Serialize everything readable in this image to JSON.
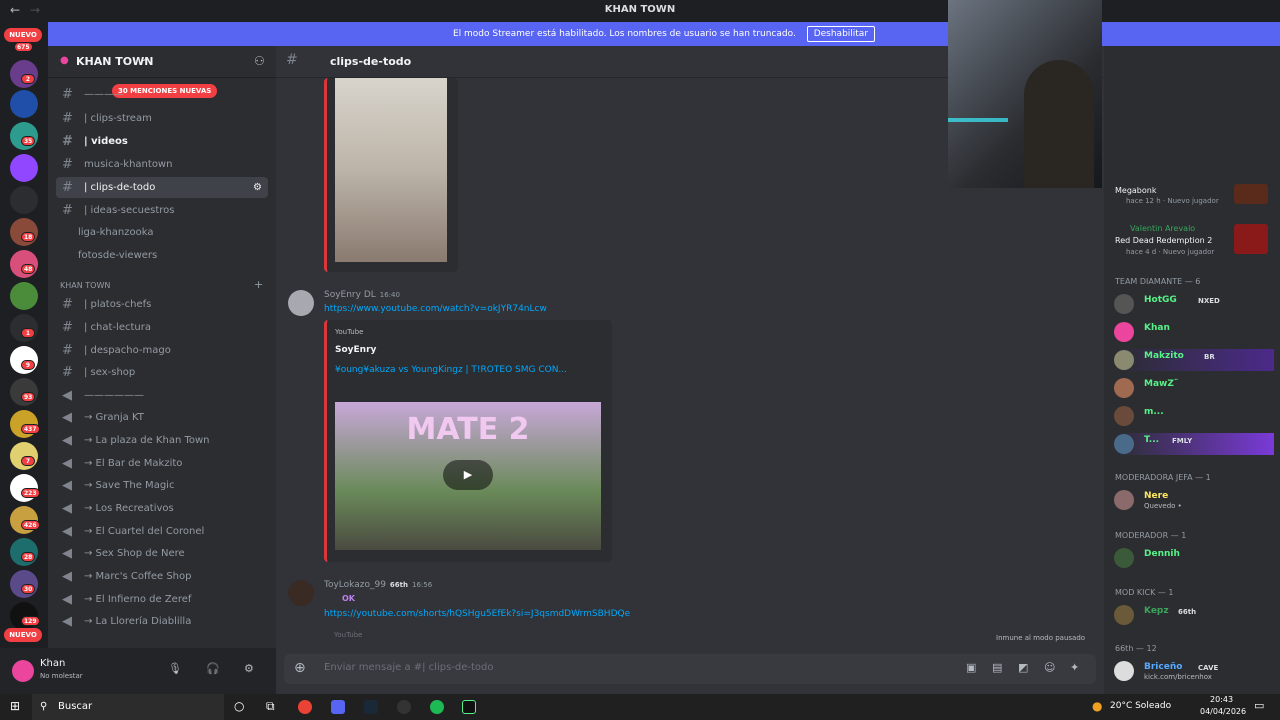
{
  "window": {
    "title": "KHAN TOWN"
  },
  "streamer_banner": {
    "text": "El modo Streamer está habilitado. Los nombres de usuario se han truncado.",
    "button": "Deshabilitar"
  },
  "guild_rail": {
    "top_badge": "NUEVO",
    "top_count": "675",
    "counts": [
      "2",
      "35",
      "18",
      "48",
      "1",
      "9",
      "93",
      "437",
      "7",
      "223",
      "426",
      "28",
      "30",
      "129"
    ],
    "bottom_badge": "NUEVO"
  },
  "server": {
    "name": "KHAN TOWN",
    "mentions_pill": "30 MENCIONES NUEVAS"
  },
  "channels": [
    {
      "label": "————",
      "unread": false
    },
    {
      "label": "| clips-stream",
      "unread": false
    },
    {
      "label": "| videos",
      "unread": true
    },
    {
      "label": "musica-khantown",
      "unread": false
    },
    {
      "label": "| clips-de-todo",
      "unread": false,
      "active": true
    },
    {
      "label": "| ideas-secuestros",
      "unread": false
    },
    {
      "label": "liga-khanzooka",
      "unread": false
    },
    {
      "label": "fotosde-viewers",
      "unread": false
    }
  ],
  "category": {
    "label": "KHAN TOWN"
  },
  "channels2": [
    {
      "label": "| platos-chefs"
    },
    {
      "label": "| chat-lectura"
    },
    {
      "label": "| despacho-mago"
    },
    {
      "label": "| sex-shop"
    },
    {
      "label": "——————"
    }
  ],
  "voice_channels": [
    {
      "label": "→ Granja KT"
    },
    {
      "label": "→ La plaza de Khan Town"
    },
    {
      "label": "→ El Bar de Makzito"
    },
    {
      "label": "→ Save The Magic"
    },
    {
      "label": "→ Los Recreativos"
    },
    {
      "label": "→ El Cuartel del Coronel"
    },
    {
      "label": "→ Sex Shop de Nere"
    },
    {
      "label": "→ Marc's Coffee Shop"
    },
    {
      "label": "→ El Infierno de Zeref"
    },
    {
      "label": "→ La Llorería Diablilla"
    }
  ],
  "user": {
    "name": "Khan",
    "status": "No molestar"
  },
  "channel_header": {
    "name": "clips-de-todo"
  },
  "messages": [
    {
      "author": "SoyEnry DL",
      "time": "16:40",
      "link": "https://www.youtube.com/watch?v=okJYR74nLcw",
      "embed": {
        "provider": "YouTube",
        "author": "SoyEnry",
        "title": "¥oung¥akuza vs YoungKingz | T!ROTEO SMG CON...",
        "thumb_text": "MATE 2"
      }
    },
    {
      "author": "ToyLokazo_99",
      "tag": "66th",
      "time": "16:56",
      "text": "OK",
      "link": "https://youtube.com/shorts/hQSHgu5EfEk?si=J3qsmdDWrmSBHDQe",
      "embed_provider": "YouTube"
    }
  ],
  "immune_note": "Inmune al modo pausado",
  "composer": {
    "placeholder": "Enviar mensaje a #| clips-de-todo"
  },
  "activity": [
    {
      "game": "Megabonk",
      "meta": "hace 12 h · Nuevo jugador"
    },
    {
      "user": "Valentin Arevalo",
      "game": "Red Dead Redemption 2",
      "meta": "hace 4 d · Nuevo jugador"
    }
  ],
  "member_groups": [
    {
      "header": "TEAM DIAMANTE — 6",
      "members": [
        {
          "name": "HotGG",
          "tag": "NXED",
          "color": "#57f287"
        },
        {
          "name": "Khan",
          "color": "#57f287"
        },
        {
          "name": "Makzito",
          "tag": "BR",
          "color": "#57f287"
        },
        {
          "name": "MawZ¨",
          "color": "#57f287"
        },
        {
          "name": "m...",
          "color": "#57f287"
        },
        {
          "name": "T...",
          "tag": "FMLY",
          "color": "#57f287"
        }
      ]
    },
    {
      "header": "MODERADORA JEFA — 1",
      "members": [
        {
          "name": "Nere",
          "status": "Quevedo •",
          "color": "#fee75c"
        }
      ]
    },
    {
      "header": "MODERADOR — 1",
      "members": [
        {
          "name": "Dennih",
          "color": "#57f287"
        }
      ]
    },
    {
      "header": "MOD KICK — 1",
      "members": [
        {
          "name": "Kepz",
          "tag": "66th",
          "color": "#3ba55c"
        }
      ]
    },
    {
      "header": "66th — 12",
      "members": [
        {
          "name": "Briceño",
          "tag": "CAVE",
          "status": "kick.com/bricenhox",
          "color": "#57aaff"
        }
      ]
    }
  ],
  "taskbar": {
    "search": "Buscar",
    "weather": "20°C  Soleado",
    "time": "20:43",
    "date": "04/04/2026"
  },
  "colors": {
    "blurple": "#5865f2",
    "red": "#f23f43",
    "bg": "#313338",
    "sidebar": "#2b2d31"
  }
}
